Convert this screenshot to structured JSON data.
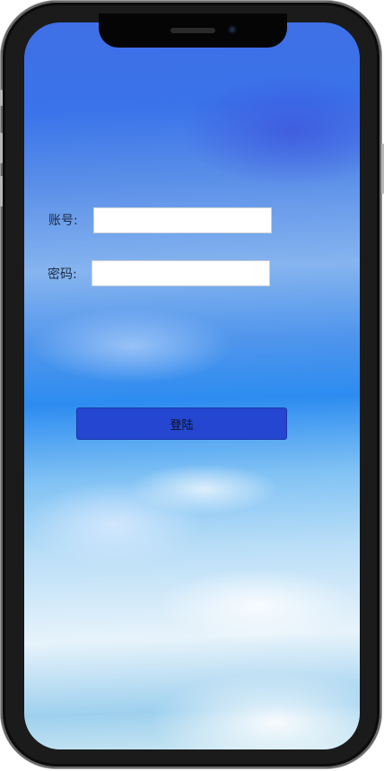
{
  "login_form": {
    "account_label": "账号:",
    "account_value": "",
    "password_label": "密码:",
    "password_value": "",
    "login_button_label": "登陆"
  },
  "colors": {
    "primary_button": "#2446d0",
    "sky_blue": "#2d8cf0",
    "frame": "#1b1b1b"
  }
}
